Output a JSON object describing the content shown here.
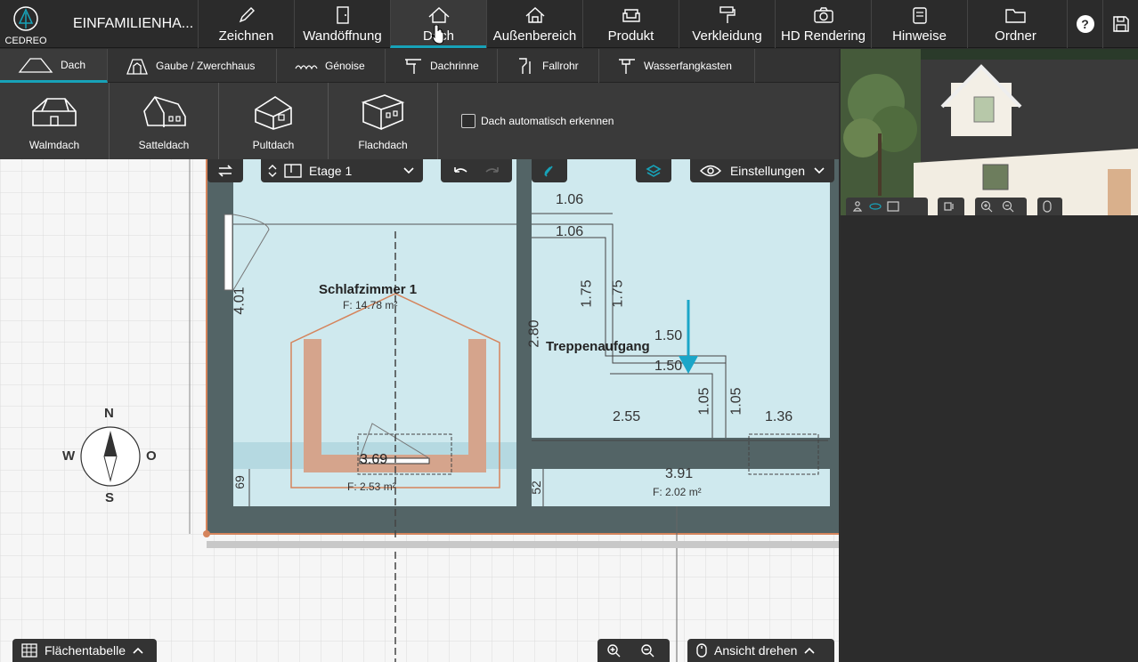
{
  "app": {
    "brand": "CEDREO",
    "project_title": "EINFAMILIENHA..."
  },
  "main_tabs": [
    {
      "label": "Zeichnen",
      "icon": "pencil-icon"
    },
    {
      "label": "Wandöffnung",
      "icon": "door-icon"
    },
    {
      "label": "Dach",
      "icon": "roof-icon",
      "active": true
    },
    {
      "label": "Außenbereich",
      "icon": "exterior-icon"
    },
    {
      "label": "Produkt",
      "icon": "armchair-icon"
    },
    {
      "label": "Verkleidung",
      "icon": "paint-roller-icon"
    },
    {
      "label": "HD Rendering",
      "icon": "camera-icon"
    },
    {
      "label": "Hinweise",
      "icon": "notes-icon"
    },
    {
      "label": "Ordner",
      "icon": "folder-icon"
    }
  ],
  "top_actions": {
    "help": "?",
    "save_icon": "save-icon"
  },
  "sub_tabs": [
    {
      "label": "Dach",
      "icon": "roof-outline-icon",
      "active": true
    },
    {
      "label": "Gaube / Zwerchhaus",
      "icon": "dormer-icon"
    },
    {
      "label": "Génoise",
      "icon": "genoise-icon"
    },
    {
      "label": "Dachrinne",
      "icon": "gutter-icon"
    },
    {
      "label": "Fallrohr",
      "icon": "downpipe-icon"
    },
    {
      "label": "Wasserfangkasten",
      "icon": "rainwater-head-icon"
    }
  ],
  "roof_types": [
    {
      "label": "Walmdach",
      "icon": "hip-roof-icon"
    },
    {
      "label": "Satteldach",
      "icon": "gable-roof-icon"
    },
    {
      "label": "Pultdach",
      "icon": "shed-roof-icon"
    },
    {
      "label": "Flachdach",
      "icon": "flat-roof-icon"
    }
  ],
  "auto_detect": {
    "label": "Dach automatisch erkennen",
    "checked": false
  },
  "plan_toolbar": {
    "floor": "Etage 1",
    "settings": "Einstellungen"
  },
  "plan": {
    "rooms": [
      {
        "name": "Schlafzimmer 1",
        "area": "F: 14.78 m²"
      },
      {
        "name": "Treppenaufgang"
      },
      {
        "area": "F: 2.53 m²"
      },
      {
        "area": "F: 2.02 m²"
      }
    ],
    "dimensions": [
      "1.06",
      "1.06",
      "1.75",
      "1.75",
      "4.01",
      "2.80",
      "1.50",
      "1.50",
      "1.05",
      "1.05",
      "2.55",
      "1.36",
      "3.69",
      "3.91",
      "69",
      "52"
    ],
    "compass": {
      "n": "N",
      "s": "S",
      "w": "W",
      "o": "O"
    }
  },
  "bottom": {
    "area_table": "Flächentabelle",
    "rotate_view": "Ansicht drehen"
  },
  "colors": {
    "accent": "#17a2b8",
    "wall": "#536466",
    "room": "#cfe9ee",
    "roof": "#d5845c"
  }
}
